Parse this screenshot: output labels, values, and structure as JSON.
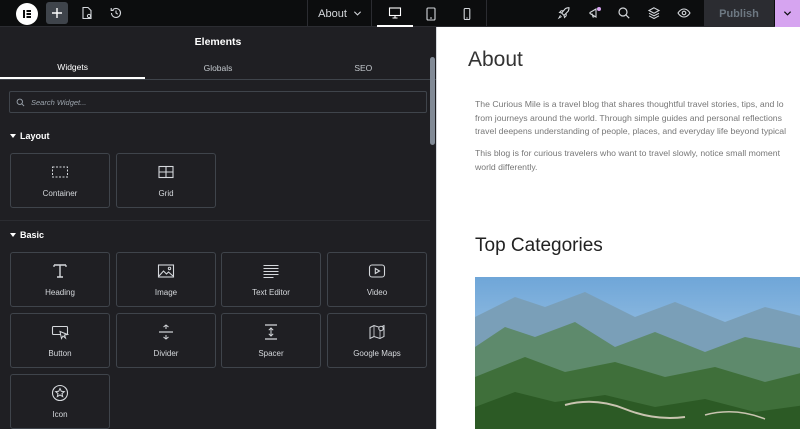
{
  "topbar": {
    "page_title": "About",
    "publish_label": "Publish",
    "icons": [
      "elementor-logo-icon",
      "plus-icon",
      "page-settings-icon",
      "history-icon",
      "desktop-icon",
      "tablet-icon",
      "mobile-icon",
      "rocket-icon",
      "announcement-icon",
      "search-icon",
      "layers-icon",
      "eye-icon",
      "chevron-down-icon"
    ]
  },
  "panel": {
    "title": "Elements",
    "tabs": [
      "Widgets",
      "Globals",
      "SEO"
    ],
    "search_placeholder": "Search Widget...",
    "sections": [
      {
        "title": "Layout",
        "widgets": [
          "Container",
          "Grid"
        ]
      },
      {
        "title": "Basic",
        "widgets": [
          "Heading",
          "Image",
          "Text Editor",
          "Video",
          "Button",
          "Divider",
          "Spacer",
          "Google Maps",
          "Icon"
        ]
      }
    ]
  },
  "canvas": {
    "title": "About",
    "paragraph1": [
      "The Curious Mile is a travel blog that shares thoughtful travel stories, tips, and lo",
      "from journeys around the world. Through simple guides and personal reflections",
      "travel deepens understanding of people, places, and everyday life beyond typical"
    ],
    "paragraph2": [
      "This blog is for curious travelers who want to travel slowly, notice small moment",
      "world differently."
    ],
    "heading2": "Top Categories"
  },
  "colors": {
    "accent": "#d6a4f0",
    "panel_bg": "#1f1f23",
    "topbar_bg": "#0c0d0e",
    "notify_dot": "#d6a4f0"
  }
}
